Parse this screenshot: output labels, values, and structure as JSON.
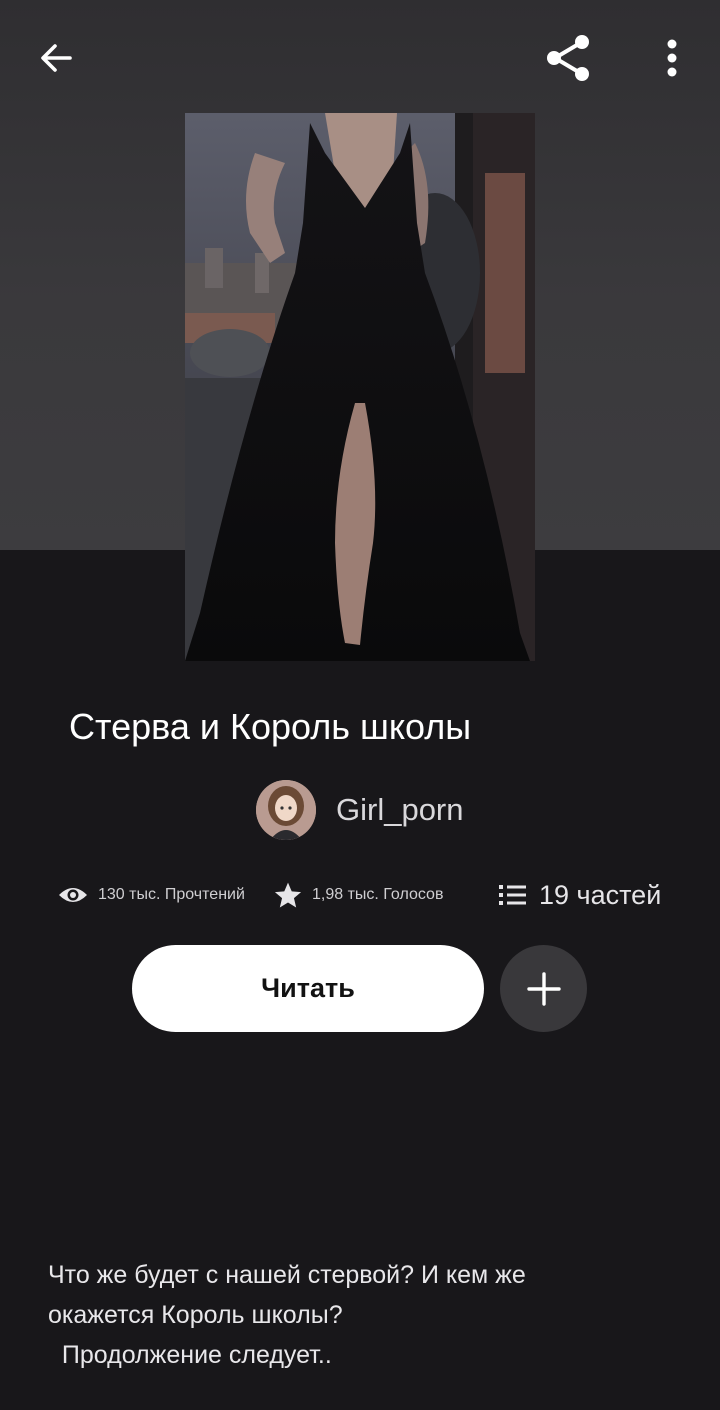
{
  "header": {
    "back_icon": "arrow-left-icon",
    "share_icon": "share-icon",
    "more_icon": "more-vertical-icon"
  },
  "story": {
    "title": "Стерва и Король школы",
    "author": "Girl_porn",
    "stats": {
      "reads": "130 тыс. Прочтений",
      "votes": "1,98 тыс. Голосов",
      "parts": "19 частей"
    },
    "read_button": "Читать",
    "description": [
      "Что же будет с нашей стервой? И кем же",
      "окажется Король школы?",
      "  Продолжение следует.."
    ]
  },
  "colors": {
    "background": "#18171a",
    "hero_background": "#3a393c",
    "button_primary": "#ffffff",
    "button_secondary": "#39383b"
  }
}
